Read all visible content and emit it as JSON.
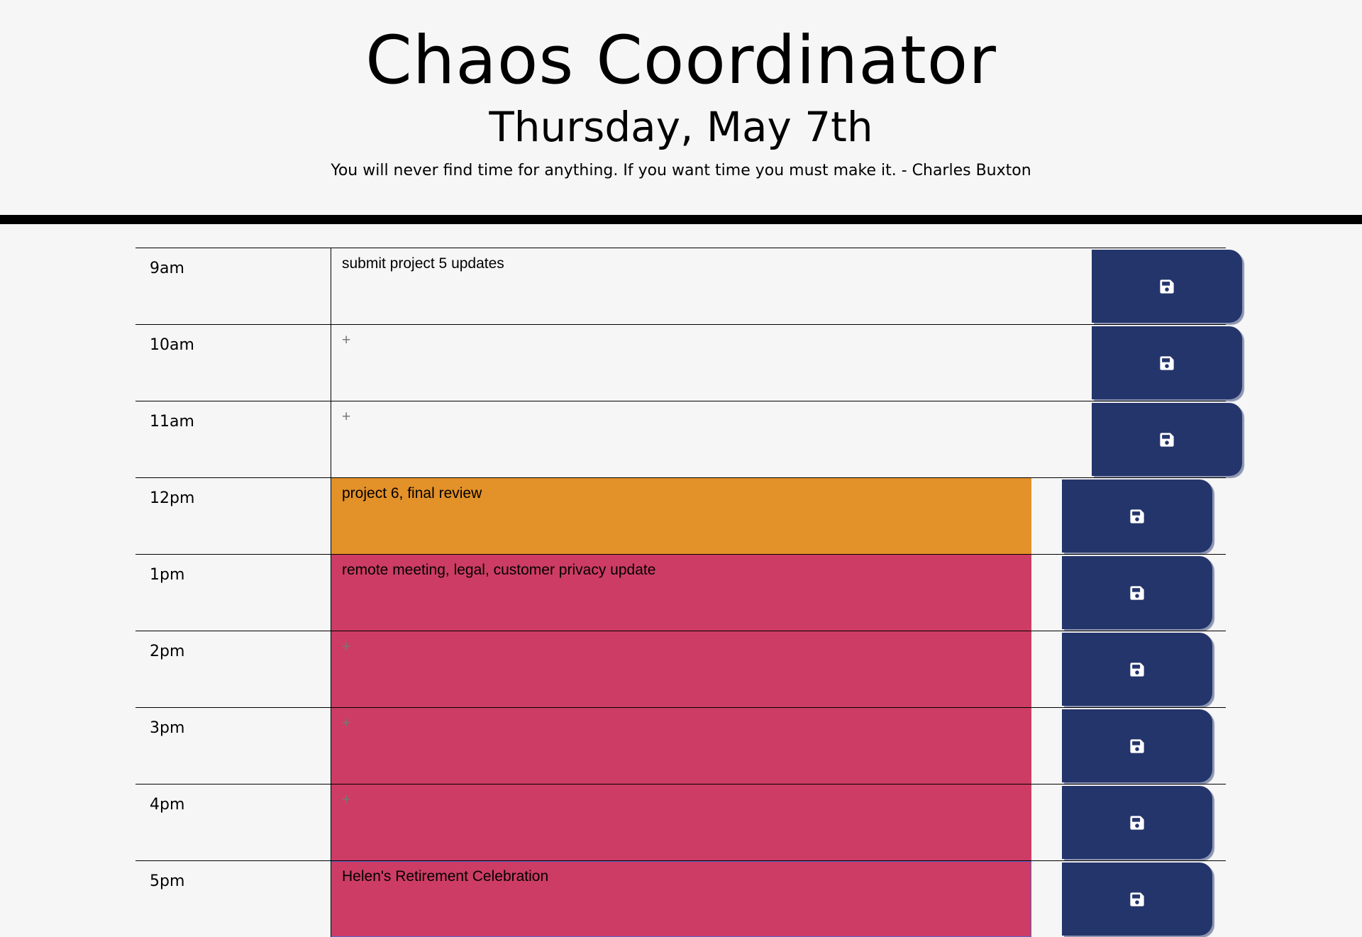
{
  "header": {
    "title": "Chaos Coordinator",
    "date": "Thursday, May 7th",
    "quote": "You will never find time for anything. If you want time you must make it. - Charles Buxton"
  },
  "rows": [
    {
      "hour": "9am",
      "text": "submit project 5 updates",
      "placeholder": "+",
      "state": "past"
    },
    {
      "hour": "10am",
      "text": "",
      "placeholder": "+",
      "state": "past"
    },
    {
      "hour": "11am",
      "text": "",
      "placeholder": "+",
      "state": "past"
    },
    {
      "hour": "12pm",
      "text": "project 6, final review",
      "placeholder": "+",
      "state": "present"
    },
    {
      "hour": "1pm",
      "text": "remote meeting, legal, customer privacy update",
      "placeholder": "+",
      "state": "future"
    },
    {
      "hour": "2pm",
      "text": "",
      "placeholder": "+",
      "state": "future"
    },
    {
      "hour": "3pm",
      "text": "",
      "placeholder": "+",
      "state": "future"
    },
    {
      "hour": "4pm",
      "text": "",
      "placeholder": "+",
      "state": "future"
    },
    {
      "hour": "5pm",
      "text": "Helen's Retirement Celebration",
      "placeholder": "+",
      "state": "future"
    }
  ],
  "colors": {
    "past": "#f7f6f6",
    "present": "#e39129",
    "future": "#cd3c64",
    "save_button": "#24356c"
  },
  "icons": {
    "save": "floppy-disk-icon"
  }
}
